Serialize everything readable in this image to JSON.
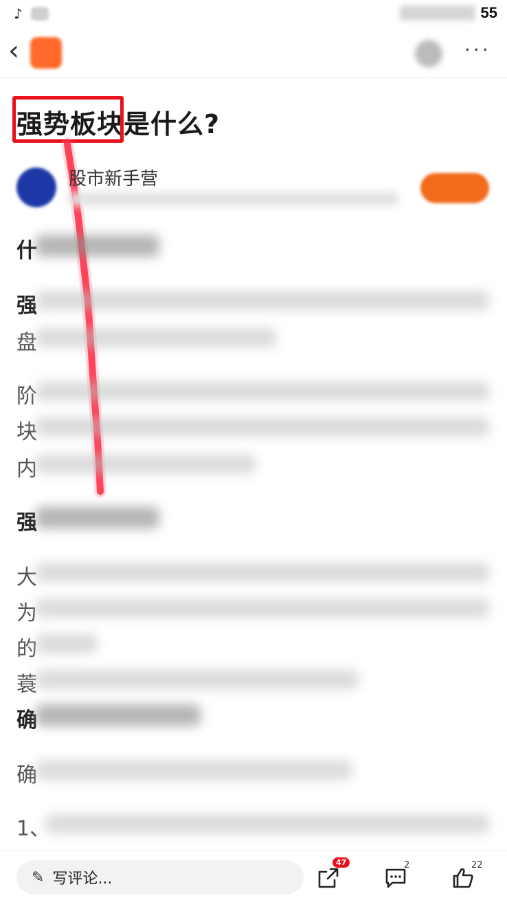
{
  "status": {
    "time": "55"
  },
  "nav": {
    "back_icon": "chevron-left-icon",
    "more": "···"
  },
  "article": {
    "title": "强势板块是什么?"
  },
  "author": {
    "name": "股市新手营"
  },
  "body_fragments": {
    "h1": "什",
    "p1a": "强",
    "p1b": "盘",
    "p2a": "阶",
    "p2b": "块",
    "p2c": "内",
    "h2": "强",
    "p3a": "大",
    "p3b": "为",
    "p3c": "的",
    "p4": "蓑",
    "h3": "确",
    "p5": "确",
    "p6": "1、"
  },
  "bottom": {
    "comment_placeholder": "写评论...",
    "share_badge": "47",
    "comment_count": "2",
    "like_count": "22"
  },
  "colors": {
    "accent": "#f26b1c",
    "highlight": "#e8121e"
  }
}
